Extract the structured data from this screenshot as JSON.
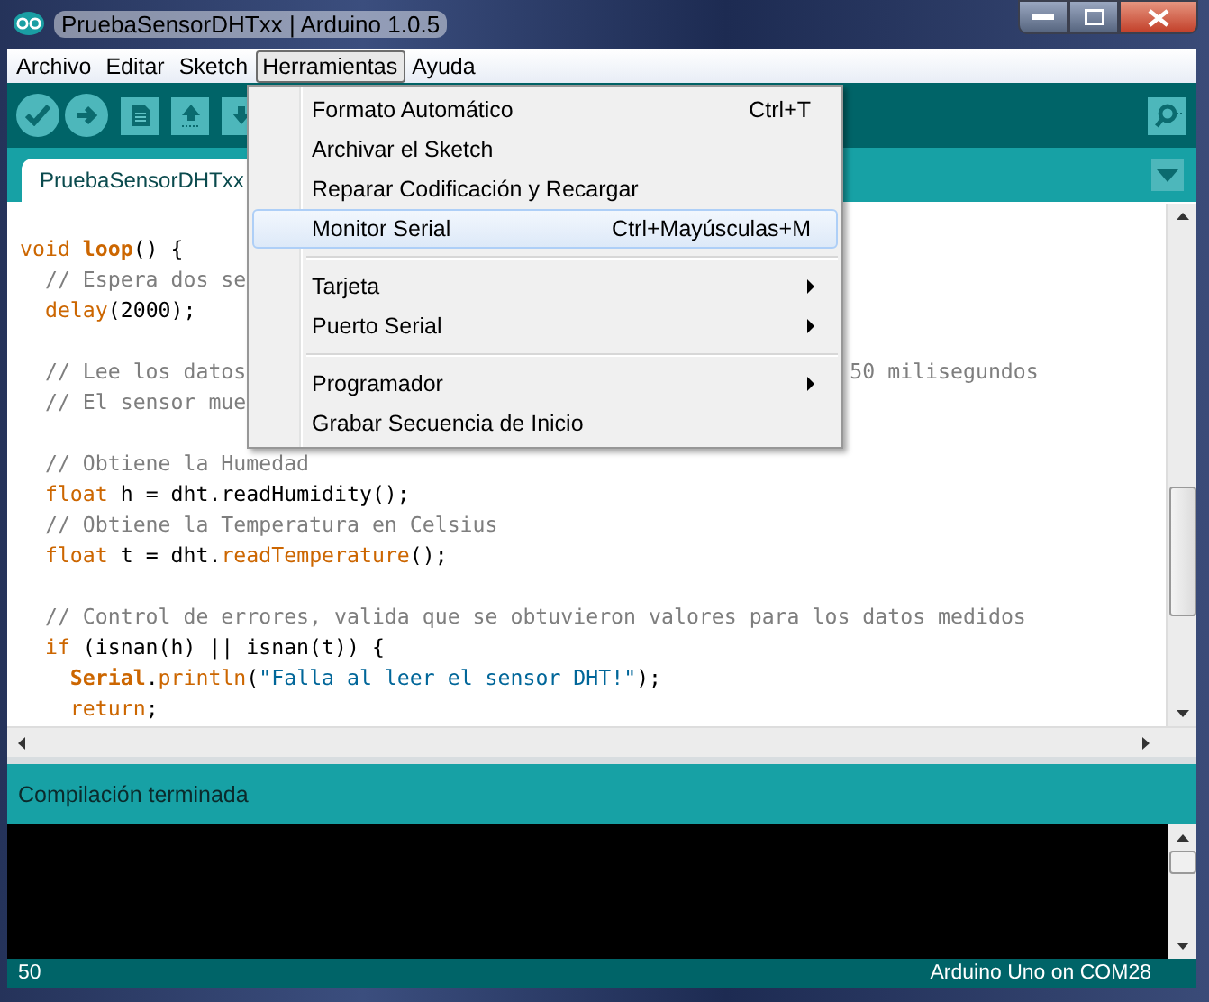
{
  "window": {
    "title": "PruebaSensorDHTxx | Arduino 1.0.5"
  },
  "menubar": [
    {
      "label": "Archivo",
      "selected": false
    },
    {
      "label": "Editar",
      "selected": false
    },
    {
      "label": "Sketch",
      "selected": false
    },
    {
      "label": "Herramientas",
      "selected": true
    },
    {
      "label": "Ayuda",
      "selected": false
    }
  ],
  "tabs": [
    {
      "label": "PruebaSensorDHTxx",
      "selected": true
    }
  ],
  "menu": [
    {
      "kind": "item",
      "label": "Formato Automático",
      "shortcut": "Ctrl+T",
      "submenu": false,
      "selected": false
    },
    {
      "kind": "item",
      "label": "Archivar el Sketch",
      "submenu": false,
      "selected": false
    },
    {
      "kind": "item",
      "label": "Reparar Codificación y Recargar",
      "submenu": false,
      "selected": false
    },
    {
      "kind": "item",
      "label": "Monitor Serial",
      "shortcut": "Ctrl+Mayúsculas+M",
      "submenu": false,
      "selected": true
    },
    {
      "kind": "separator"
    },
    {
      "kind": "item",
      "label": "Tarjeta",
      "submenu": true,
      "selected": false
    },
    {
      "kind": "item",
      "label": "Puerto Serial",
      "submenu": true,
      "selected": false
    },
    {
      "kind": "separator"
    },
    {
      "kind": "item",
      "label": "Programador",
      "submenu": true,
      "selected": false
    },
    {
      "kind": "item",
      "label": "Grabar Secuencia de Inicio",
      "submenu": false,
      "selected": false
    }
  ],
  "code": [
    {
      "kind": "code",
      "tokens": [
        {
          "kind": "keyword",
          "text": "void"
        },
        {
          "kind": "function",
          "text": " loop"
        },
        {
          "kind": "plain",
          "text": "() {"
        }
      ]
    },
    {
      "kind": "code",
      "tokens": [
        {
          "kind": "comment",
          "text": "  // Espera dos se"
        }
      ]
    },
    {
      "kind": "code",
      "tokens": [
        {
          "kind": "keyword",
          "text": "  delay"
        },
        {
          "kind": "plain",
          "text": "(2000);"
        }
      ]
    },
    {
      "kind": "blank"
    },
    {
      "kind": "code",
      "tokens": [
        {
          "kind": "comment",
          "text": "  // Lee los datos"
        }
      ],
      "after_menu": [
        {
          "kind": "comment",
          "text": "50 milisegundos"
        }
      ]
    },
    {
      "kind": "code",
      "tokens": [
        {
          "kind": "comment",
          "text": "  // El sensor mue"
        }
      ]
    },
    {
      "kind": "blank"
    },
    {
      "kind": "code",
      "tokens": [
        {
          "kind": "comment",
          "text": "  // Obtiene la Humedad"
        }
      ]
    },
    {
      "kind": "code",
      "tokens": [
        {
          "kind": "keyword",
          "text": "  float"
        },
        {
          "kind": "plain",
          "text": " h = dht.readHumidity();"
        }
      ]
    },
    {
      "kind": "code",
      "tokens": [
        {
          "kind": "comment",
          "text": "  // Obtiene la Temperatura en Celsius"
        }
      ]
    },
    {
      "kind": "code",
      "tokens": [
        {
          "kind": "keyword",
          "text": "  float"
        },
        {
          "kind": "plain",
          "text": " t = dht."
        },
        {
          "kind": "keyword",
          "text": "readTemperature"
        },
        {
          "kind": "plain",
          "text": "();"
        }
      ]
    },
    {
      "kind": "blank"
    },
    {
      "kind": "code",
      "tokens": [
        {
          "kind": "comment",
          "text": "  // Control de errores, valida que se obtuvieron valores para los datos medidos"
        }
      ]
    },
    {
      "kind": "code",
      "tokens": [
        {
          "kind": "keyword",
          "text": "  if"
        },
        {
          "kind": "plain",
          "text": " (isnan(h) || isnan(t)) {"
        }
      ]
    },
    {
      "kind": "code",
      "tokens": [
        {
          "kind": "function",
          "text": "    Serial"
        },
        {
          "kind": "plain",
          "text": "."
        },
        {
          "kind": "keyword",
          "text": "println"
        },
        {
          "kind": "plain",
          "text": "("
        },
        {
          "kind": "string",
          "text": "\"Falla al leer el sensor DHT!\""
        },
        {
          "kind": "plain",
          "text": ");"
        }
      ]
    },
    {
      "kind": "code",
      "tokens": [
        {
          "kind": "keyword",
          "text": "    return"
        },
        {
          "kind": "plain",
          "text": ";"
        }
      ]
    }
  ],
  "status": {
    "message": "Compilación terminada"
  },
  "footer": {
    "line": "50",
    "board": "Arduino Uno on COM28"
  }
}
